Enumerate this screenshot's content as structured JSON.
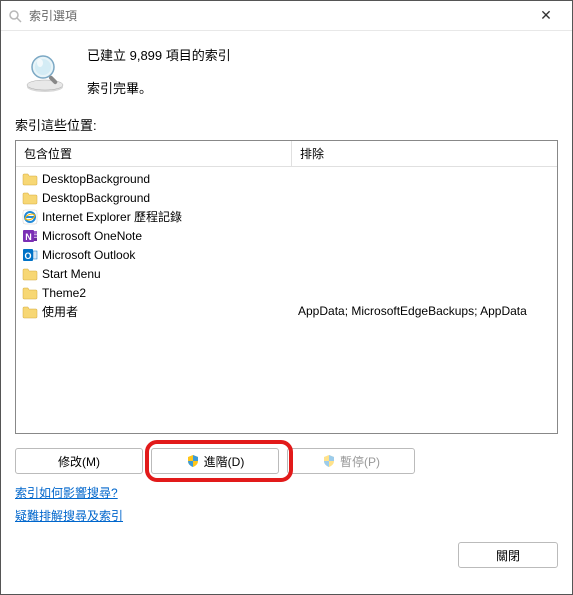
{
  "titlebar": {
    "title": "索引選項"
  },
  "status": {
    "line1": "已建立 9,899 項目的索引",
    "line2": "索引完畢。"
  },
  "section_label": "索引這些位置:",
  "columns": {
    "included": "包含位置",
    "excluded": "排除"
  },
  "locations": [
    {
      "icon": "folder",
      "name": "DesktopBackground",
      "excluded": ""
    },
    {
      "icon": "folder",
      "name": "DesktopBackground",
      "excluded": ""
    },
    {
      "icon": "ie",
      "name": "Internet Explorer 歷程記錄",
      "excluded": ""
    },
    {
      "icon": "onenote",
      "name": "Microsoft OneNote",
      "excluded": ""
    },
    {
      "icon": "outlook",
      "name": "Microsoft Outlook",
      "excluded": ""
    },
    {
      "icon": "folder",
      "name": "Start Menu",
      "excluded": ""
    },
    {
      "icon": "folder",
      "name": "Theme2",
      "excluded": ""
    },
    {
      "icon": "folder",
      "name": "使用者",
      "excluded": "AppData; MicrosoftEdgeBackups; AppData"
    }
  ],
  "buttons": {
    "modify": "修改(M)",
    "advanced": "進階(D)",
    "pause": "暫停(P)",
    "close": "關閉"
  },
  "links": {
    "help": "索引如何影響搜尋?",
    "troubleshoot": "疑難排解搜尋及索引"
  }
}
